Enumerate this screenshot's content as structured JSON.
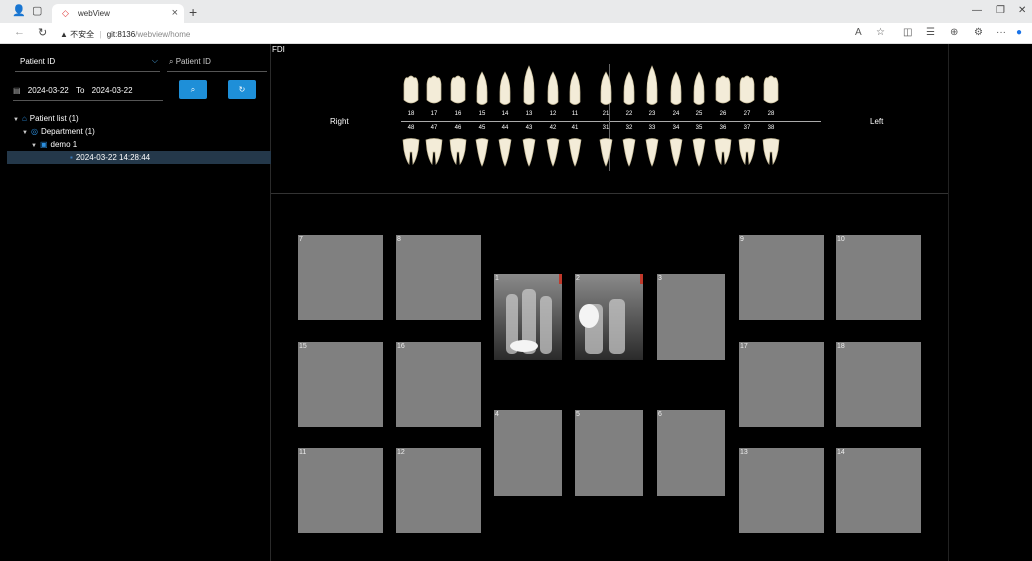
{
  "browser": {
    "tab_title": "webView",
    "url_warning": "不安全",
    "url_host": "git:8136",
    "url_path": "/webview/home"
  },
  "sidebar": {
    "patient_select": "Patient ID",
    "patient_search_placeholder": "Patient ID",
    "date_from": "2024-03-22",
    "date_to_label": "To",
    "date_to": "2024-03-22",
    "tree": [
      {
        "label": "Patient list (1)",
        "level": 0,
        "icon": "home-icon",
        "selected": false
      },
      {
        "label": "Department (1)",
        "level": 1,
        "icon": "department-icon",
        "selected": false
      },
      {
        "label": "demo 1",
        "level": 2,
        "icon": "patient-icon",
        "selected": false
      },
      {
        "label": "2024-03-22 14:28:44",
        "level": 3,
        "icon": "study-icon",
        "selected": true
      }
    ]
  },
  "chart": {
    "system_label": "FDI",
    "right_label": "Right",
    "left_label": "Left",
    "upper_numbers": [
      "18",
      "17",
      "16",
      "15",
      "14",
      "13",
      "12",
      "11",
      "21",
      "22",
      "23",
      "24",
      "25",
      "26",
      "27",
      "28"
    ],
    "lower_numbers": [
      "48",
      "47",
      "46",
      "45",
      "44",
      "43",
      "42",
      "41",
      "31",
      "32",
      "33",
      "34",
      "35",
      "36",
      "37",
      "38"
    ]
  },
  "viewer": {
    "slots": [
      {
        "num": "7"
      },
      {
        "num": "8"
      },
      {
        "num": "1",
        "image": true
      },
      {
        "num": "2",
        "image": true
      },
      {
        "num": "3"
      },
      {
        "num": "9"
      },
      {
        "num": "10"
      },
      {
        "num": "15"
      },
      {
        "num": "16"
      },
      {
        "num": "17"
      },
      {
        "num": "18"
      },
      {
        "num": "4"
      },
      {
        "num": "5"
      },
      {
        "num": "6"
      },
      {
        "num": "11"
      },
      {
        "num": "12"
      },
      {
        "num": "13"
      },
      {
        "num": "14"
      }
    ]
  }
}
